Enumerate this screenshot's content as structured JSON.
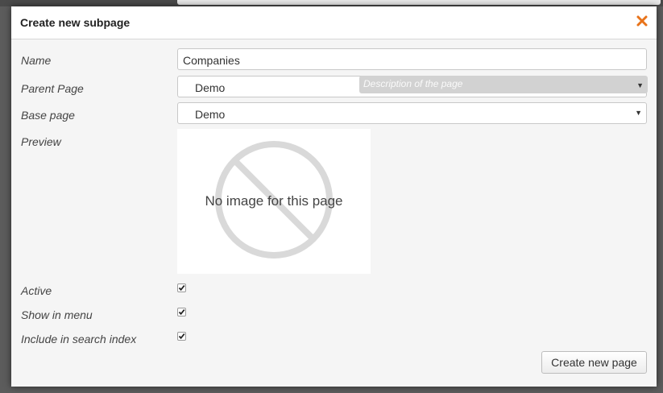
{
  "dialog": {
    "title": "Create new subpage",
    "close_icon": "close-x-icon",
    "accent_color": "#e8731a"
  },
  "form": {
    "name": {
      "label": "Name",
      "value": "Companies"
    },
    "parent_page": {
      "label": "Parent Page",
      "selected": "Demo",
      "tooltip": "Description of the page"
    },
    "base_page": {
      "label": "Base page",
      "selected": "Demo"
    },
    "preview": {
      "label": "Preview",
      "placeholder_text": "No image for this page",
      "placeholder_icon": "no-image-icon"
    },
    "active": {
      "label": "Active",
      "checked": true
    },
    "show_in_menu": {
      "label": "Show in menu",
      "checked": true
    },
    "include_in_search_index": {
      "label": "Include in search index",
      "checked": true
    }
  },
  "actions": {
    "create_label": "Create new page"
  }
}
